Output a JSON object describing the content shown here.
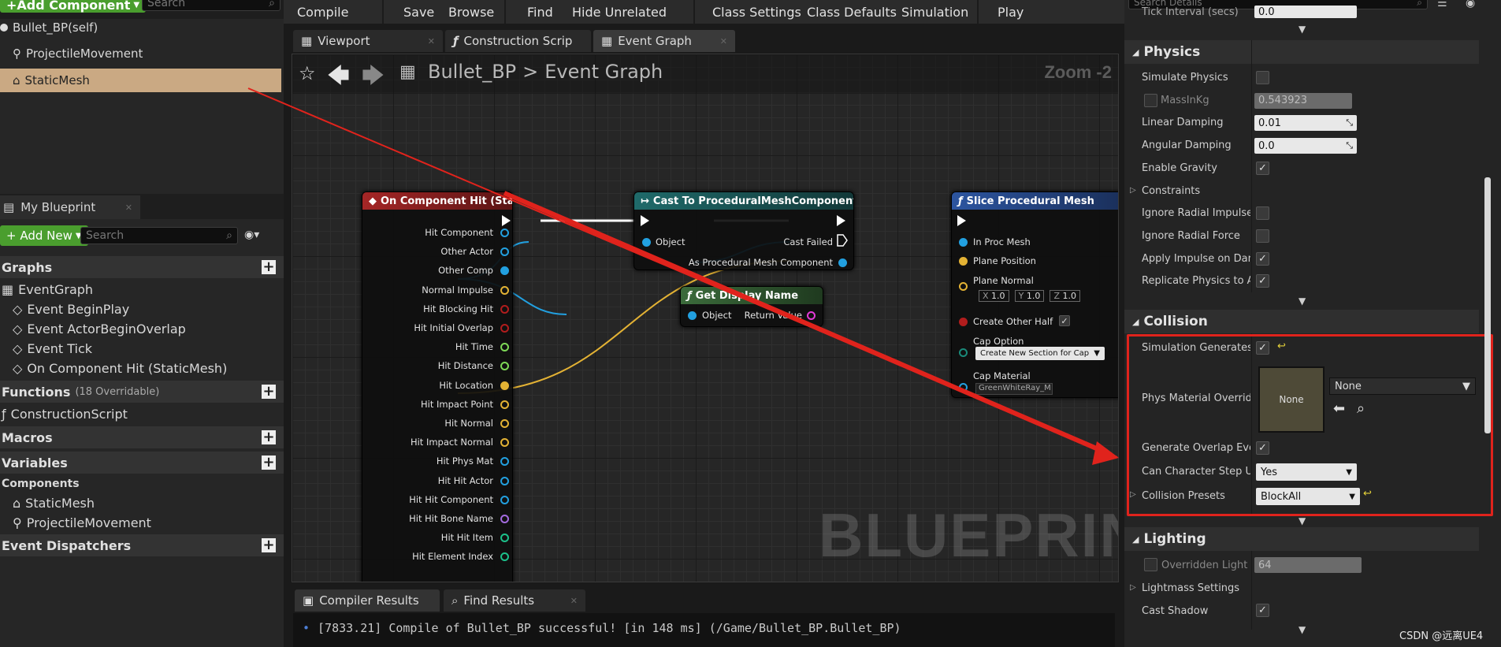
{
  "left": {
    "add_component": "+Add Component",
    "search_placeholder": "Search",
    "components": [
      {
        "label": "Bullet_BP(self)",
        "icon": "circle-icon"
      },
      {
        "label": "ProjectileMovement",
        "icon": "projectile-icon"
      },
      {
        "label": "StaticMesh",
        "icon": "mesh-icon"
      }
    ],
    "my_blueprint_tab": "My Blueprint",
    "add_new": "+ Add New",
    "search2_placeholder": "Search",
    "graphs_header": "Graphs",
    "graphs": [
      "EventGraph",
      "Event BeginPlay",
      "Event ActorBeginOverlap",
      "Event Tick",
      "On Component Hit (StaticMesh)"
    ],
    "functions_header": "Functions",
    "functions_count": "(18 Overridable)",
    "functions": [
      "ConstructionScript"
    ],
    "macros_header": "Macros",
    "variables_header": "Variables",
    "components_header": "Components",
    "var_components": [
      "StaticMesh",
      "ProjectileMovement"
    ],
    "dispatchers_header": "Event Dispatchers"
  },
  "toolbar": {
    "buttons": [
      "Compile",
      "Save",
      "Browse",
      "Find",
      "Hide Unrelated",
      "Class Settings",
      "Class Defaults",
      "Simulation",
      "Play"
    ]
  },
  "tabs": [
    "Viewport",
    "Construction Scrip",
    "Event Graph"
  ],
  "graph": {
    "breadcrumb_bp": "Bullet_BP",
    "breadcrumb_sep": ">",
    "breadcrumb_graph": "Event Graph",
    "zoom": "Zoom -2",
    "watermark": "BLUEPRINT",
    "node_hit": {
      "title": "On Component Hit (StaticMesh)",
      "pins": [
        "Hit Component",
        "Other Actor",
        "Other Comp",
        "Normal Impulse",
        "Hit Blocking Hit",
        "Hit Initial Overlap",
        "Hit Time",
        "Hit Distance",
        "Hit Location",
        "Hit Impact Point",
        "Hit Normal",
        "Hit Impact Normal",
        "Hit Phys Mat",
        "Hit Hit Actor",
        "Hit Hit Component",
        "Hit Hit Bone Name",
        "Hit Hit Item",
        "Hit Element Index"
      ]
    },
    "node_cast": {
      "title": "Cast To ProceduralMeshComponent",
      "object": "Object",
      "cast_failed": "Cast Failed",
      "as_pmc": "As Procedural Mesh Component"
    },
    "node_display": {
      "title": "Get Display Name",
      "object": "Object",
      "return": "Return Value"
    },
    "node_slice": {
      "title": "Slice Procedural Mesh",
      "in_proc": "In Proc Mesh",
      "plane_pos": "Plane Position",
      "plane_normal": "Plane Normal",
      "x_label": "X",
      "x_val": "1.0",
      "y_label": "Y",
      "y_val": "1.0",
      "z_label": "Z",
      "z_val": "1.0",
      "create_other": "Create Other Half",
      "cap_option": "Cap Option",
      "cap_value": "Create New Section for Cap",
      "cap_material": "Cap Material",
      "cap_mat_value": "GreenWhiteRay_M"
    }
  },
  "bottom": {
    "tabs": [
      "Compiler Results",
      "Find Results"
    ],
    "log": "[7833.21] Compile of Bullet_BP successful! [in 148 ms] (/Game/Bullet_BP.Bullet_BP)"
  },
  "details": {
    "search_placeholder": "Search Details",
    "tick_interval": "Tick Interval (secs)",
    "tick_value": "0.0",
    "physics_header": "Physics",
    "physics": [
      {
        "label": "Simulate Physics",
        "type": "check",
        "checked": false
      },
      {
        "label": "MassInKg",
        "type": "dimnum",
        "value": "0.543923"
      },
      {
        "label": "Linear Damping",
        "type": "num",
        "value": "0.01"
      },
      {
        "label": "Angular Damping",
        "type": "num",
        "value": "0.0"
      },
      {
        "label": "Enable Gravity",
        "type": "check",
        "checked": true
      },
      {
        "label": "Constraints",
        "type": "expand"
      },
      {
        "label": "Ignore Radial Impulse",
        "type": "check",
        "checked": false
      },
      {
        "label": "Ignore Radial Force",
        "type": "check",
        "checked": false
      },
      {
        "label": "Apply Impulse on Damage",
        "type": "check",
        "checked": true
      },
      {
        "label": "Replicate Physics to Autonomous Proxy",
        "type": "check",
        "checked": true
      }
    ],
    "collision_header": "Collision",
    "sim_gen_hit": "Simulation Generates Hit Events",
    "phys_mat": "Phys Material Override",
    "phys_mat_thumb": "None",
    "phys_mat_dd": "None",
    "gen_overlap": "Generate Overlap Events",
    "can_step": "Can Character Step Up On",
    "can_step_value": "Yes",
    "presets": "Collision Presets",
    "presets_value": "BlockAll",
    "lighting_header": "Lighting",
    "overridden_light": "Overridden Light Map Res",
    "overridden_value": "64",
    "lightmass": "Lightmass Settings",
    "cast_shadow": "Cast Shadow"
  },
  "watermark_csdn": "CSDN @远离UE4",
  "colors": {
    "highlight": "#e0231c",
    "selected_row": "#caa983",
    "hit_header": "#8a1e1e",
    "cast_header": "#1d5a5a",
    "func_header": "#27447a",
    "display_header": "#2f5a2f"
  }
}
